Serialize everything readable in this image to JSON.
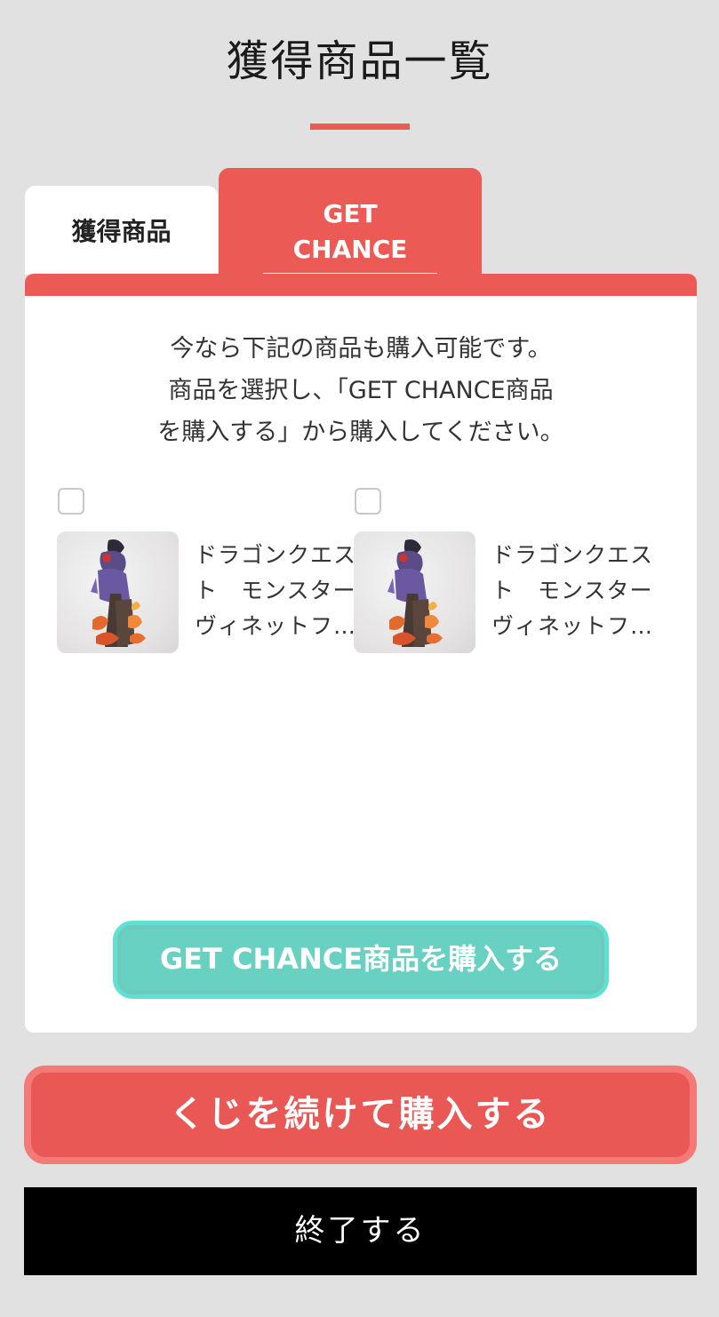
{
  "page": {
    "title": "獲得商品一覧"
  },
  "tabs": [
    {
      "label": "獲得商品",
      "active": false
    },
    {
      "label": "GET CHANCE",
      "active": true
    }
  ],
  "intro": {
    "lines": [
      "今なら下記の商品も購入可能です。",
      "商品を選択し、「GET CHANCE商品",
      "を購入する」から購入してください。"
    ]
  },
  "products": [
    {
      "checked": false,
      "name_lines": [
        "ドラゴンクエス",
        "ト　モンスター",
        "ヴィネットフ…"
      ],
      "image_icon": "figure-image"
    },
    {
      "checked": false,
      "name_lines": [
        "ドラゴンクエス",
        "ト　モンスター",
        "ヴィネットフ…"
      ],
      "image_icon": "figure-image"
    }
  ],
  "buttons": {
    "get_chance": "GET CHANCE商品を購入する",
    "continue_kuji": "くじを続けて購入する",
    "finish": "終了する"
  },
  "colors": {
    "accent_red": "#ec5a55",
    "teal": "#68d1c2",
    "background": "#e1e1e1"
  }
}
